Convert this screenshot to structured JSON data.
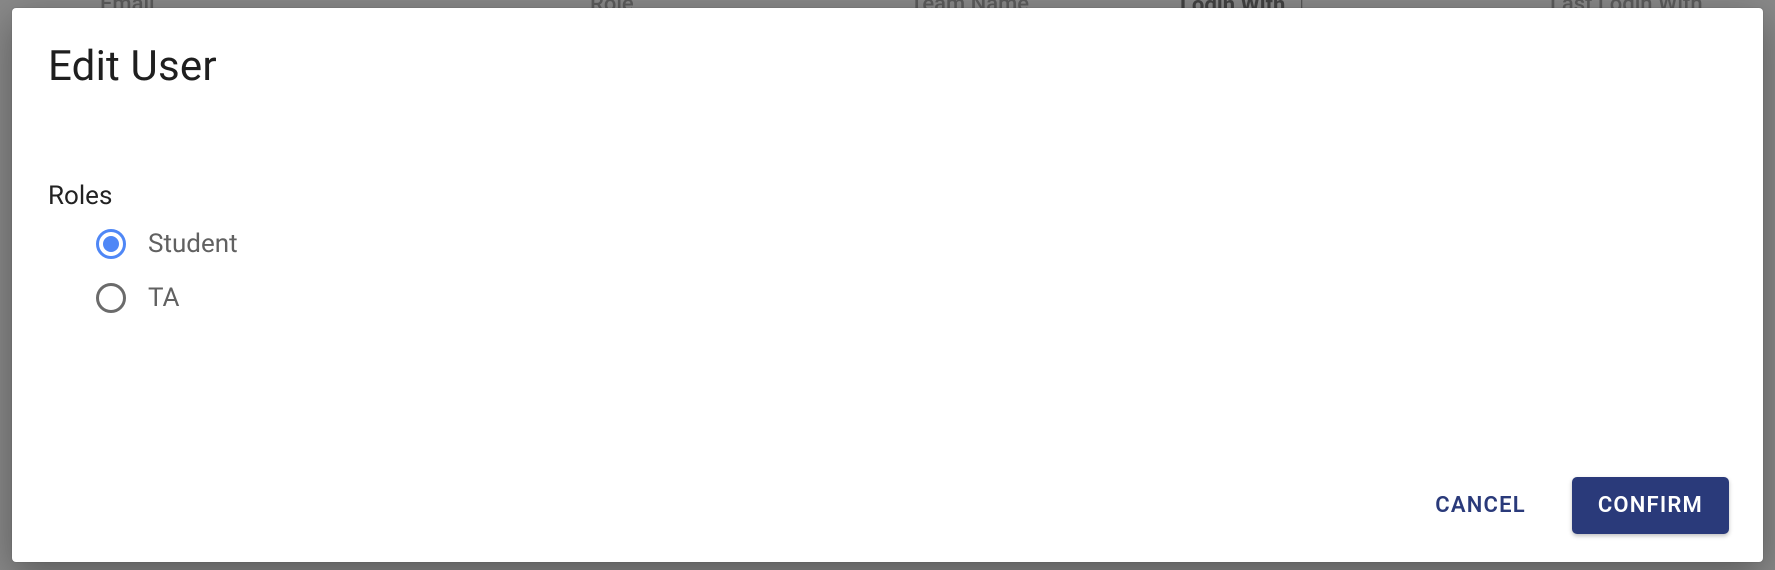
{
  "background": {
    "columns": {
      "email": "Email",
      "role": "Role",
      "team_name": "Team Name",
      "login_with": "Login With",
      "last_login_with": "Last Login With"
    }
  },
  "dialog": {
    "title": "Edit User",
    "roles_label": "Roles",
    "options": [
      {
        "label": "Student",
        "selected": true
      },
      {
        "label": "TA",
        "selected": false
      }
    ],
    "cancel_label": "Cancel",
    "confirm_label": "Confirm"
  }
}
